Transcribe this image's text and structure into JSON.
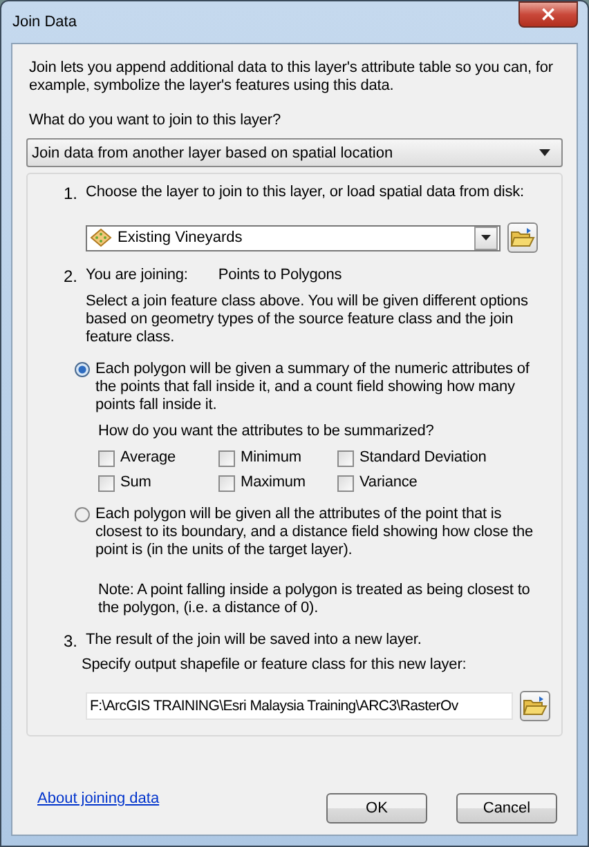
{
  "window": {
    "title": "Join Data",
    "close": "×"
  },
  "intro": "Join lets you append additional data to this layer's attribute table so you can, for example, symbolize the layer's features using this data.",
  "join_question": "What do you want to join to this layer?",
  "join_type": {
    "value": "Join data from another layer based on spatial location"
  },
  "step1": {
    "number": "1.",
    "label": "Choose the layer to join to this layer, or load spatial data from disk:",
    "layer": {
      "value": "Existing Vineyards"
    }
  },
  "step2": {
    "number": "2.",
    "label": "You are joining:",
    "joining": "Points to Polygons",
    "hint": "Select a join feature class above.  You will be given different options based on geometry types of the source feature class and the join feature class."
  },
  "options": [
    {
      "label": "Each polygon will be given a summary of the numeric attributes of the points that fall inside it, and a count field showing how many points fall inside it.",
      "selected": true
    },
    {
      "label": "Each polygon will be given all the attributes of the point that is closest to its boundary, and a distance field showing how close the point is (in the units of the target layer).",
      "selected": false
    }
  ],
  "summary_question": "How do you want the attributes to be summarized?",
  "summaries": [
    {
      "label": "Average",
      "checked": false
    },
    {
      "label": "Minimum",
      "checked": false
    },
    {
      "label": "Standard Deviation",
      "checked": false
    },
    {
      "label": "Sum",
      "checked": false
    },
    {
      "label": "Maximum",
      "checked": false
    },
    {
      "label": "Variance",
      "checked": false
    }
  ],
  "note": "Note: A point falling inside a polygon is treated as being closest to the polygon, (i.e. a distance of 0).",
  "step3": {
    "number": "3.",
    "label": "The result of the join will be saved into a new layer.",
    "sublabel": "Specify output shapefile or feature class for this new layer:",
    "output": {
      "value": "F:\\ArcGIS TRAINING\\Esri Malaysia Training\\ARC3\\RasterOv"
    }
  },
  "help_link": "About joining data",
  "buttons": [
    "OK",
    "Cancel"
  ]
}
